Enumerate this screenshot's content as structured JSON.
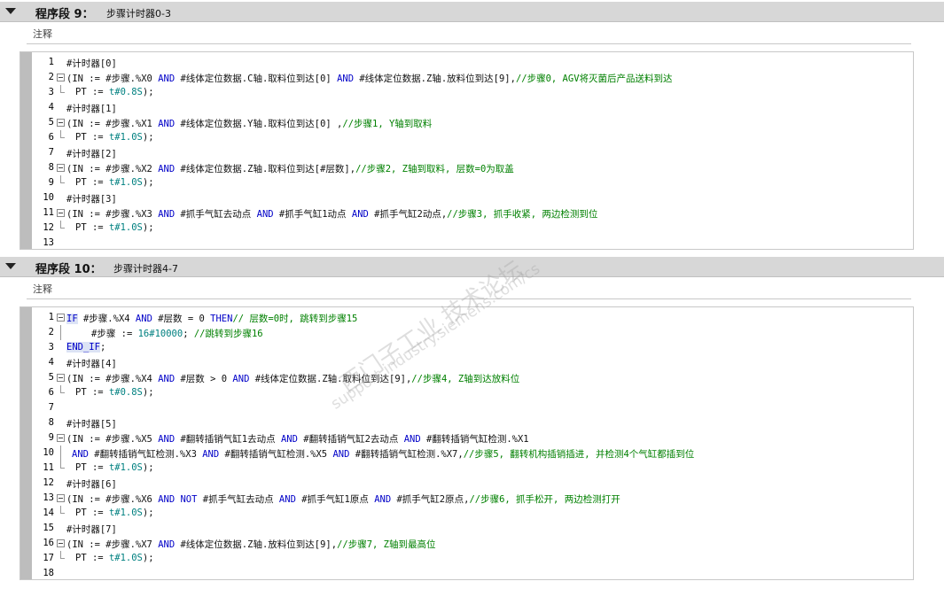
{
  "segments": [
    {
      "title": "程序段 9：",
      "name": "步骤计时器0-3",
      "comment_label": "注释",
      "lines": [
        {
          "n": "1",
          "text": "#计时器[0]"
        },
        {
          "n": "2",
          "text": "(IN := #步骤.%X0 AND #线体定位数据.C轴.取料位到达[0] AND #线体定位数据.Z轴.放料位到达[9],//步骤0, AGV将灭菌后产品送料到达"
        },
        {
          "n": "3",
          "text": "PT := t#0.8S);"
        },
        {
          "n": "4",
          "text": "#计时器[1]"
        },
        {
          "n": "5",
          "text": "(IN := #步骤.%X1 AND #线体定位数据.Y轴.取料位到达[0] ,//步骤1, Y轴到取料"
        },
        {
          "n": "6",
          "text": "PT := t#1.0S);"
        },
        {
          "n": "7",
          "text": "#计时器[2]"
        },
        {
          "n": "8",
          "text": "(IN := #步骤.%X2 AND #线体定位数据.Z轴.取料位到达[#层数],//步骤2, Z轴到取料, 层数=0为取盖"
        },
        {
          "n": "9",
          "text": "PT := t#1.0S);"
        },
        {
          "n": "10",
          "text": "#计时器[3]"
        },
        {
          "n": "11",
          "text": "(IN := #步骤.%X3 AND #抓手气缸去动点 AND #抓手气缸1动点 AND #抓手气缸2动点,//步骤3, 抓手收紧, 两边检测到位"
        },
        {
          "n": "12",
          "text": "PT := t#1.0S);"
        },
        {
          "n": "13",
          "text": ""
        }
      ]
    },
    {
      "title": "程序段 10：",
      "name": "步骤计时器4-7",
      "comment_label": "注释",
      "lines": [
        {
          "n": "1",
          "text": "IF #步骤.%X4 AND #层数 = 0 THEN// 层数=0时, 跳转到步骤15"
        },
        {
          "n": "2",
          "text": "#步骤 := 16#10000; //跳转到步骤16"
        },
        {
          "n": "3",
          "text": "END_IF;"
        },
        {
          "n": "4",
          "text": "#计时器[4]"
        },
        {
          "n": "5",
          "text": "(IN := #步骤.%X4 AND #层数 > 0 AND #线体定位数据.Z轴.取料位到达[9],//步骤4, Z轴到达放料位"
        },
        {
          "n": "6",
          "text": "PT := t#0.8S);"
        },
        {
          "n": "7",
          "text": ""
        },
        {
          "n": "8",
          "text": "#计时器[5]"
        },
        {
          "n": "9",
          "text": "(IN := #步骤.%X5 AND #翻转插销气缸1去动点 AND #翻转插销气缸2去动点 AND #翻转插销气缸检测.%X1"
        },
        {
          "n": "10",
          "text": "AND #翻转插销气缸检测.%X3 AND #翻转插销气缸检测.%X5 AND #翻转插销气缸检测.%X7,//步骤5, 翻转机构插销插进, 并检测4个气缸都插到位"
        },
        {
          "n": "11",
          "text": "PT := t#1.0S);"
        },
        {
          "n": "12",
          "text": "#计时器[6]"
        },
        {
          "n": "13",
          "text": "(IN := #步骤.%X6 AND NOT #抓手气缸去动点 AND #抓手气缸1原点 AND #抓手气缸2原点,//步骤6, 抓手松开, 两边检测打开"
        },
        {
          "n": "14",
          "text": "PT := t#1.0S);"
        },
        {
          "n": "15",
          "text": "#计时器[7]"
        },
        {
          "n": "16",
          "text": "(IN := #步骤.%X7 AND #线体定位数据.Z轴.放料位到达[9],//步骤7, Z轴到最高位"
        },
        {
          "n": "17",
          "text": "PT := t#1.0S);"
        },
        {
          "n": "18",
          "text": ""
        }
      ]
    }
  ],
  "watermark": {
    "line1": "西门子工业  技术论坛",
    "line2": "support.industry.siemens.com/cs"
  }
}
